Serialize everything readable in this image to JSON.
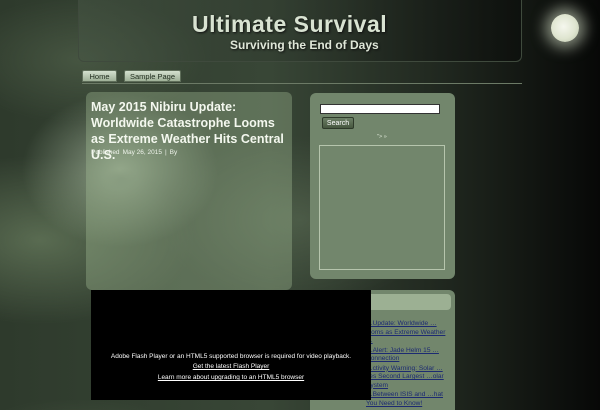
{
  "header": {
    "title": "Ultimate Survival",
    "tagline": "Surviving the End of Days"
  },
  "nav": {
    "items": [
      {
        "label": "Home"
      },
      {
        "label": "Sample Page"
      }
    ]
  },
  "post": {
    "title": "May 2015 Nibiru Update: Worldwide Catastrophe Looms as Extreme Weather Hits Central U.S.",
    "meta_published": "Published",
    "meta_date": "May 26, 2015",
    "meta_separator": "|",
    "meta_by": "By"
  },
  "sidebar": {
    "search_input_value": "",
    "search_button_label": "Search",
    "widget_glyph": "\"> »",
    "recent_posts": [
      {
        "label": "…Update: Worldwide …looms as Extreme Weather …"
      },
      {
        "label": "…Alert: Jade Helm 15 …Connection"
      },
      {
        "label": "…ctivity Warning: Solar …ses Second Largest …olar System"
      },
      {
        "label": "…Between ISIS and …hat You Need to Know!"
      }
    ]
  },
  "flash": {
    "message": "Adobe Flash Player or an HTML5 supported browser is required for video playback.",
    "link_get": "Get the latest Flash Player",
    "link_learn": "Learn more about upgrading to an HTML5 browser"
  },
  "colors": {
    "accent_green": "#72866c",
    "link_blue": "#1c2a72",
    "title_text": "#f4f8ef"
  }
}
